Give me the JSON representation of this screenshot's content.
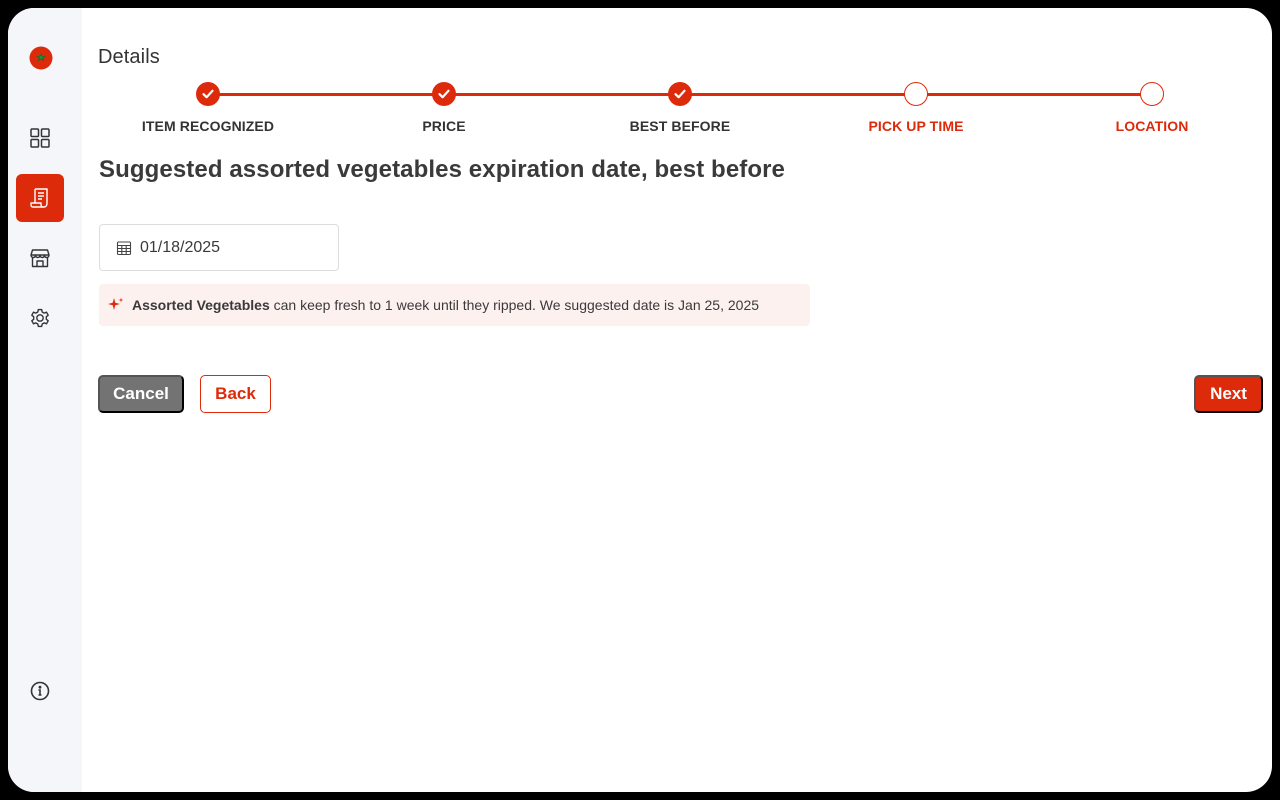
{
  "sidebar": {
    "logo_icon": "tomato-logo",
    "items": [
      {
        "name": "dashboard",
        "icon": "grid-icon",
        "active": false
      },
      {
        "name": "listings",
        "icon": "receipt-icon",
        "active": true
      },
      {
        "name": "store",
        "icon": "store-icon",
        "active": false
      },
      {
        "name": "settings",
        "icon": "gear-icon",
        "active": false
      }
    ],
    "footer_icon": "info-icon"
  },
  "header": {
    "title": "Details"
  },
  "stepper": {
    "steps": [
      {
        "label": "ITEM RECOGNIZED",
        "completed": true
      },
      {
        "label": "PRICE",
        "completed": true
      },
      {
        "label": "BEST BEFORE",
        "completed": true
      },
      {
        "label": "PICK UP TIME",
        "completed": false
      },
      {
        "label": "LOCATION",
        "completed": false
      }
    ]
  },
  "content": {
    "headline": "Suggested assorted vegetables expiration date, best before",
    "date_value": "01/18/2025",
    "suggestion": {
      "item_name": "Assorted Vegetables",
      "text": "can keep fresh to 1 week until they ripped. We suggested date is Jan 25, 2025"
    }
  },
  "actions": {
    "cancel": "Cancel",
    "back": "Back",
    "next": "Next"
  },
  "colors": {
    "accent": "#dd2a0b",
    "cancel_bg": "#737373",
    "suggestion_bg": "#fdf1ef",
    "sidebar_bg": "#f5f6fa"
  }
}
